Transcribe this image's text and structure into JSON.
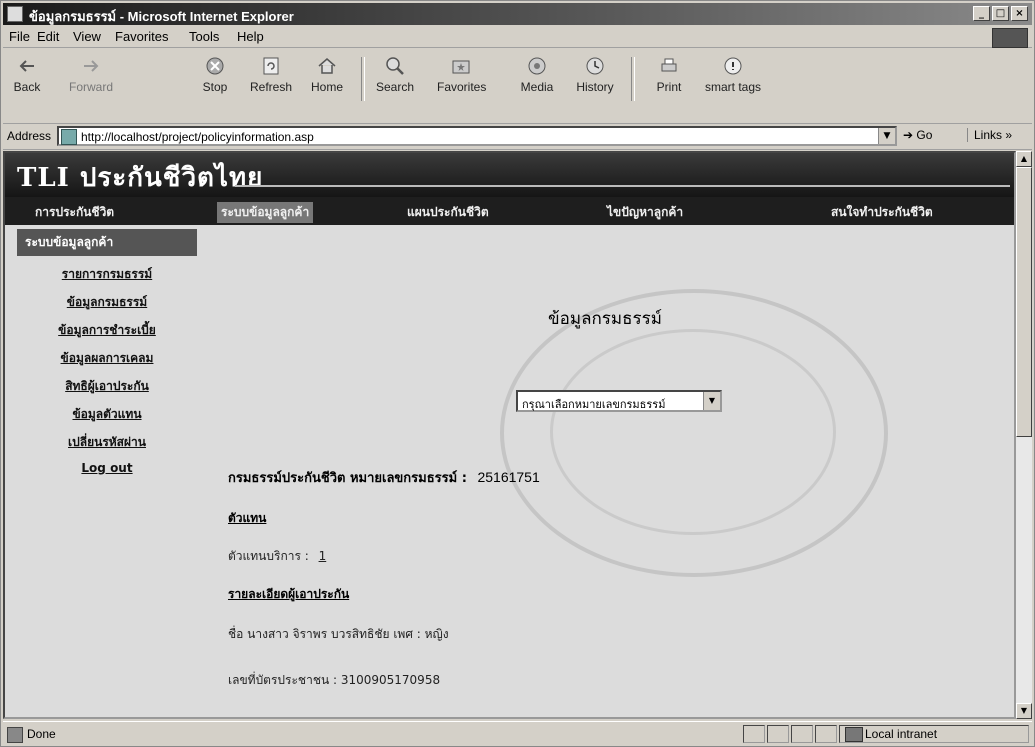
{
  "window": {
    "title": "ข้อมูลกรมธรรม์ - Microsoft Internet Explorer"
  },
  "menu": [
    "File",
    "Edit",
    "View",
    "Favorites",
    "Tools",
    "Help"
  ],
  "toolbar": {
    "back": "Back",
    "forward": "Forward",
    "stop": "Stop",
    "refresh": "Refresh",
    "home": "Home",
    "search": "Search",
    "favorites": "Favorites",
    "media": "Media",
    "history": "History",
    "print": "Print",
    "smart_tags": "smart tags"
  },
  "address": {
    "label": "Address",
    "url": "http://localhost/project/policyinformation.asp",
    "go": "Go",
    "links": "Links »"
  },
  "site": {
    "brand": "TLI ประกันชีวิตไทย",
    "nav": [
      "การประกันชีวิต",
      "ระบบข้อมูลลูกค้า",
      "แผนประกันชีวิต",
      "ไขปัญหาลูกค้า",
      "สนใจทำประกันชีวิต"
    ],
    "sidebar": {
      "heading": "ระบบข้อมูลลูกค้า",
      "links": [
        "รายการกรมธรรม์",
        "ข้อมูลกรมธรรม์",
        "ข้อมูลการชำระเบี้ย",
        "ข้อมูลผลการเคลม",
        "สิทธิผู้เอาประกัน",
        "ข้อมูลตัวแทน",
        "เปลี่ยนรหัสผ่าน",
        "Log out"
      ]
    },
    "main": {
      "title": "ข้อมูลกรมธรรม์",
      "select_placeholder": "กรุณาเลือกหมายเลขกรมธรรม์",
      "policy_label": "กรมธรรม์ประกันชีวิต หมายเลขกรมธรรม์ :",
      "policy_number": "25161751",
      "agent_heading": "ตัวแทน",
      "agent_label": "ตัวแทนบริการ :",
      "agent_value": "1",
      "insured_heading": "รายละเอียดผู้เอาประกัน",
      "name_line": "ชื่อ นางสาว จิราพร บวรสิทธิชัย เพศ : หญิง",
      "id_line": "เลขที่บัตรประชาชน : 3100905170958"
    }
  },
  "status": {
    "text": "Done",
    "zone": "Local intranet"
  }
}
